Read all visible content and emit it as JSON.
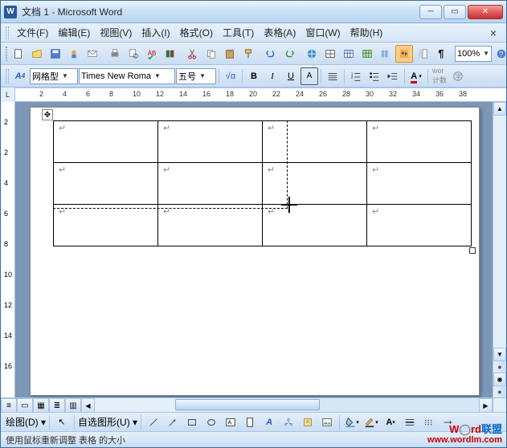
{
  "title": "文档 1 - Microsoft Word",
  "appicon": "W",
  "menu": {
    "file": "文件(F)",
    "edit": "编辑(E)",
    "view": "视图(V)",
    "insert": "插入(I)",
    "format": "格式(O)",
    "tools": "工具(T)",
    "table": "表格(A)",
    "window": "窗口(W)",
    "help": "帮助(H)"
  },
  "zoom": "100%",
  "style_combo": "网格型",
  "font_combo": "Times New Roma",
  "size_combo": "五号",
  "ruler_box": "L",
  "ruler_ticks": [
    "2",
    "4",
    "6",
    "8",
    "10",
    "12",
    "14",
    "16",
    "18",
    "20",
    "22",
    "24",
    "26",
    "28",
    "30",
    "32",
    "34",
    "36",
    "38"
  ],
  "vruler_ticks": [
    "2",
    "2",
    "4",
    "6",
    "8",
    "10",
    "12",
    "14",
    "16"
  ],
  "draw_label": "绘图(D)",
  "autoshape_label": "自选图形(U)",
  "status": "使用鼠标重新调整 表格 的大小",
  "watermark": {
    "t1": "W",
    "t2": "rd",
    "t3": "联盟",
    "url": "www.wordlm.com"
  }
}
